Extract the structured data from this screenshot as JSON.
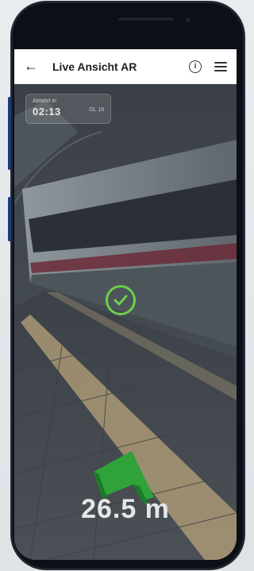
{
  "app": {
    "title": "Live Ansicht AR"
  },
  "header": {
    "back_icon": "arrow-left-icon",
    "info_icon": "info-icon",
    "menu_icon": "hamburger-menu-icon"
  },
  "departure": {
    "label": "Abfahrt in",
    "time": "02:13",
    "track": "GL 19"
  },
  "status": {
    "check_icon": "checkmark-circle-icon",
    "check_color": "#6bd14a"
  },
  "navigation": {
    "distance": "26.5 m",
    "arrow_icon": "green-direction-arrow-icon",
    "arrow_color": "#2fa33a"
  },
  "colors": {
    "accent_green": "#6bd14a"
  }
}
